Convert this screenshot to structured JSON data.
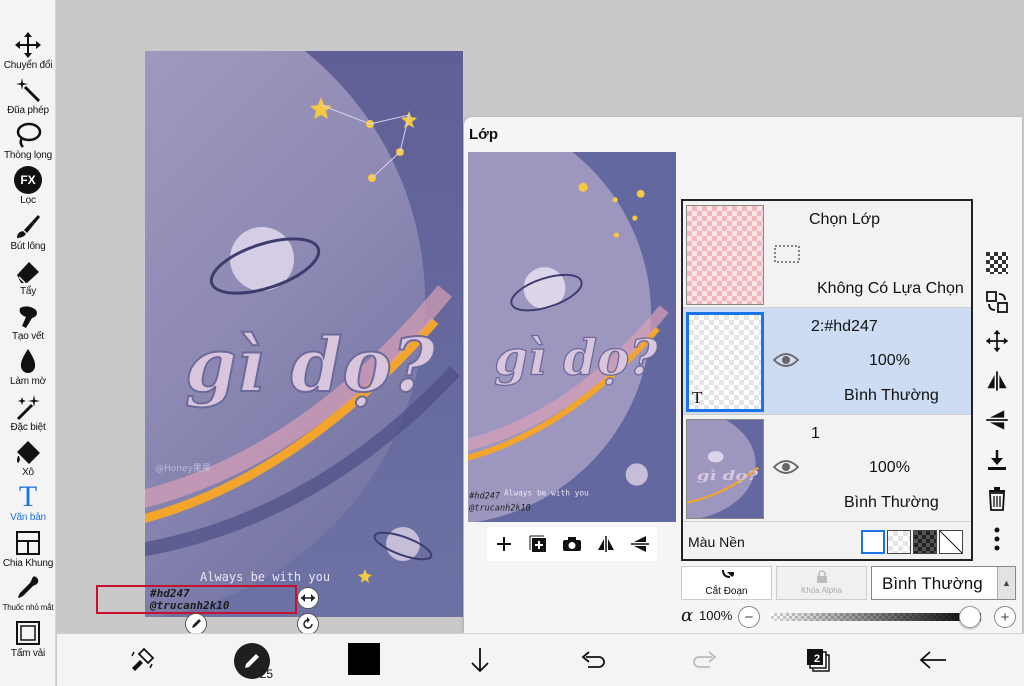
{
  "toolbar": {
    "tools": [
      {
        "label": "Chuyển đổi",
        "icon": "move-icon"
      },
      {
        "label": "Đũa phép",
        "icon": "magic-wand-icon"
      },
      {
        "label": "Thòng lọng",
        "icon": "lasso-icon"
      },
      {
        "label": "Lọc",
        "icon": "fx-icon",
        "badge": "FX"
      },
      {
        "label": "Bút lông",
        "icon": "brush-icon"
      },
      {
        "label": "Tẩy",
        "icon": "eraser-icon"
      },
      {
        "label": "Tạo vết",
        "icon": "smudge-icon"
      },
      {
        "label": "Làm mờ",
        "icon": "blur-icon"
      },
      {
        "label": "Đặc biệt",
        "icon": "special-icon"
      },
      {
        "label": "Xô",
        "icon": "bucket-icon"
      },
      {
        "label": "Văn bản",
        "icon": "text-icon",
        "glyph": "T",
        "active": true
      },
      {
        "label": "Chia Khung",
        "icon": "frame-divider-icon"
      },
      {
        "label": "Thuốc nhỏ mắt",
        "icon": "eyedropper-icon"
      },
      {
        "label": "Tấm vải",
        "icon": "canvas-icon"
      }
    ]
  },
  "artwork": {
    "title_text": "gì dọ?",
    "tagline": "Always be with you",
    "watermark": "@Honey果果",
    "text_layer_lines": [
      "#hd247",
      "@trucanh2k10"
    ]
  },
  "layer_panel": {
    "title": "Lớp",
    "layers": [
      {
        "name": "Chọn Lớp",
        "subtitle": "Không Có Lựa Chọn",
        "type": "selection"
      },
      {
        "name": "2:#hd247",
        "opacity": "100%",
        "blend": "Bình Thường",
        "type_glyph": "T",
        "selected": true
      },
      {
        "name": "1",
        "opacity": "100%",
        "blend": "Bình Thường",
        "selected": false
      }
    ],
    "background_label": "Màu Nền",
    "clipping_label": "Cắt Đoạn",
    "alpha_lock_label": "Khóa Alpha",
    "blend_mode": "Bình Thường",
    "alpha_symbol": "α",
    "alpha_value": "100%",
    "alpha_fraction": 1.0
  },
  "bottom_bar": {
    "brush_size": "25",
    "layer_count": "2",
    "color": "#000000"
  },
  "colors": {
    "accent": "#1a73e8",
    "selection_border": "#c8102e",
    "layer_selected_bg": "#cddcf3",
    "art_bg": "#6b6f9e"
  }
}
